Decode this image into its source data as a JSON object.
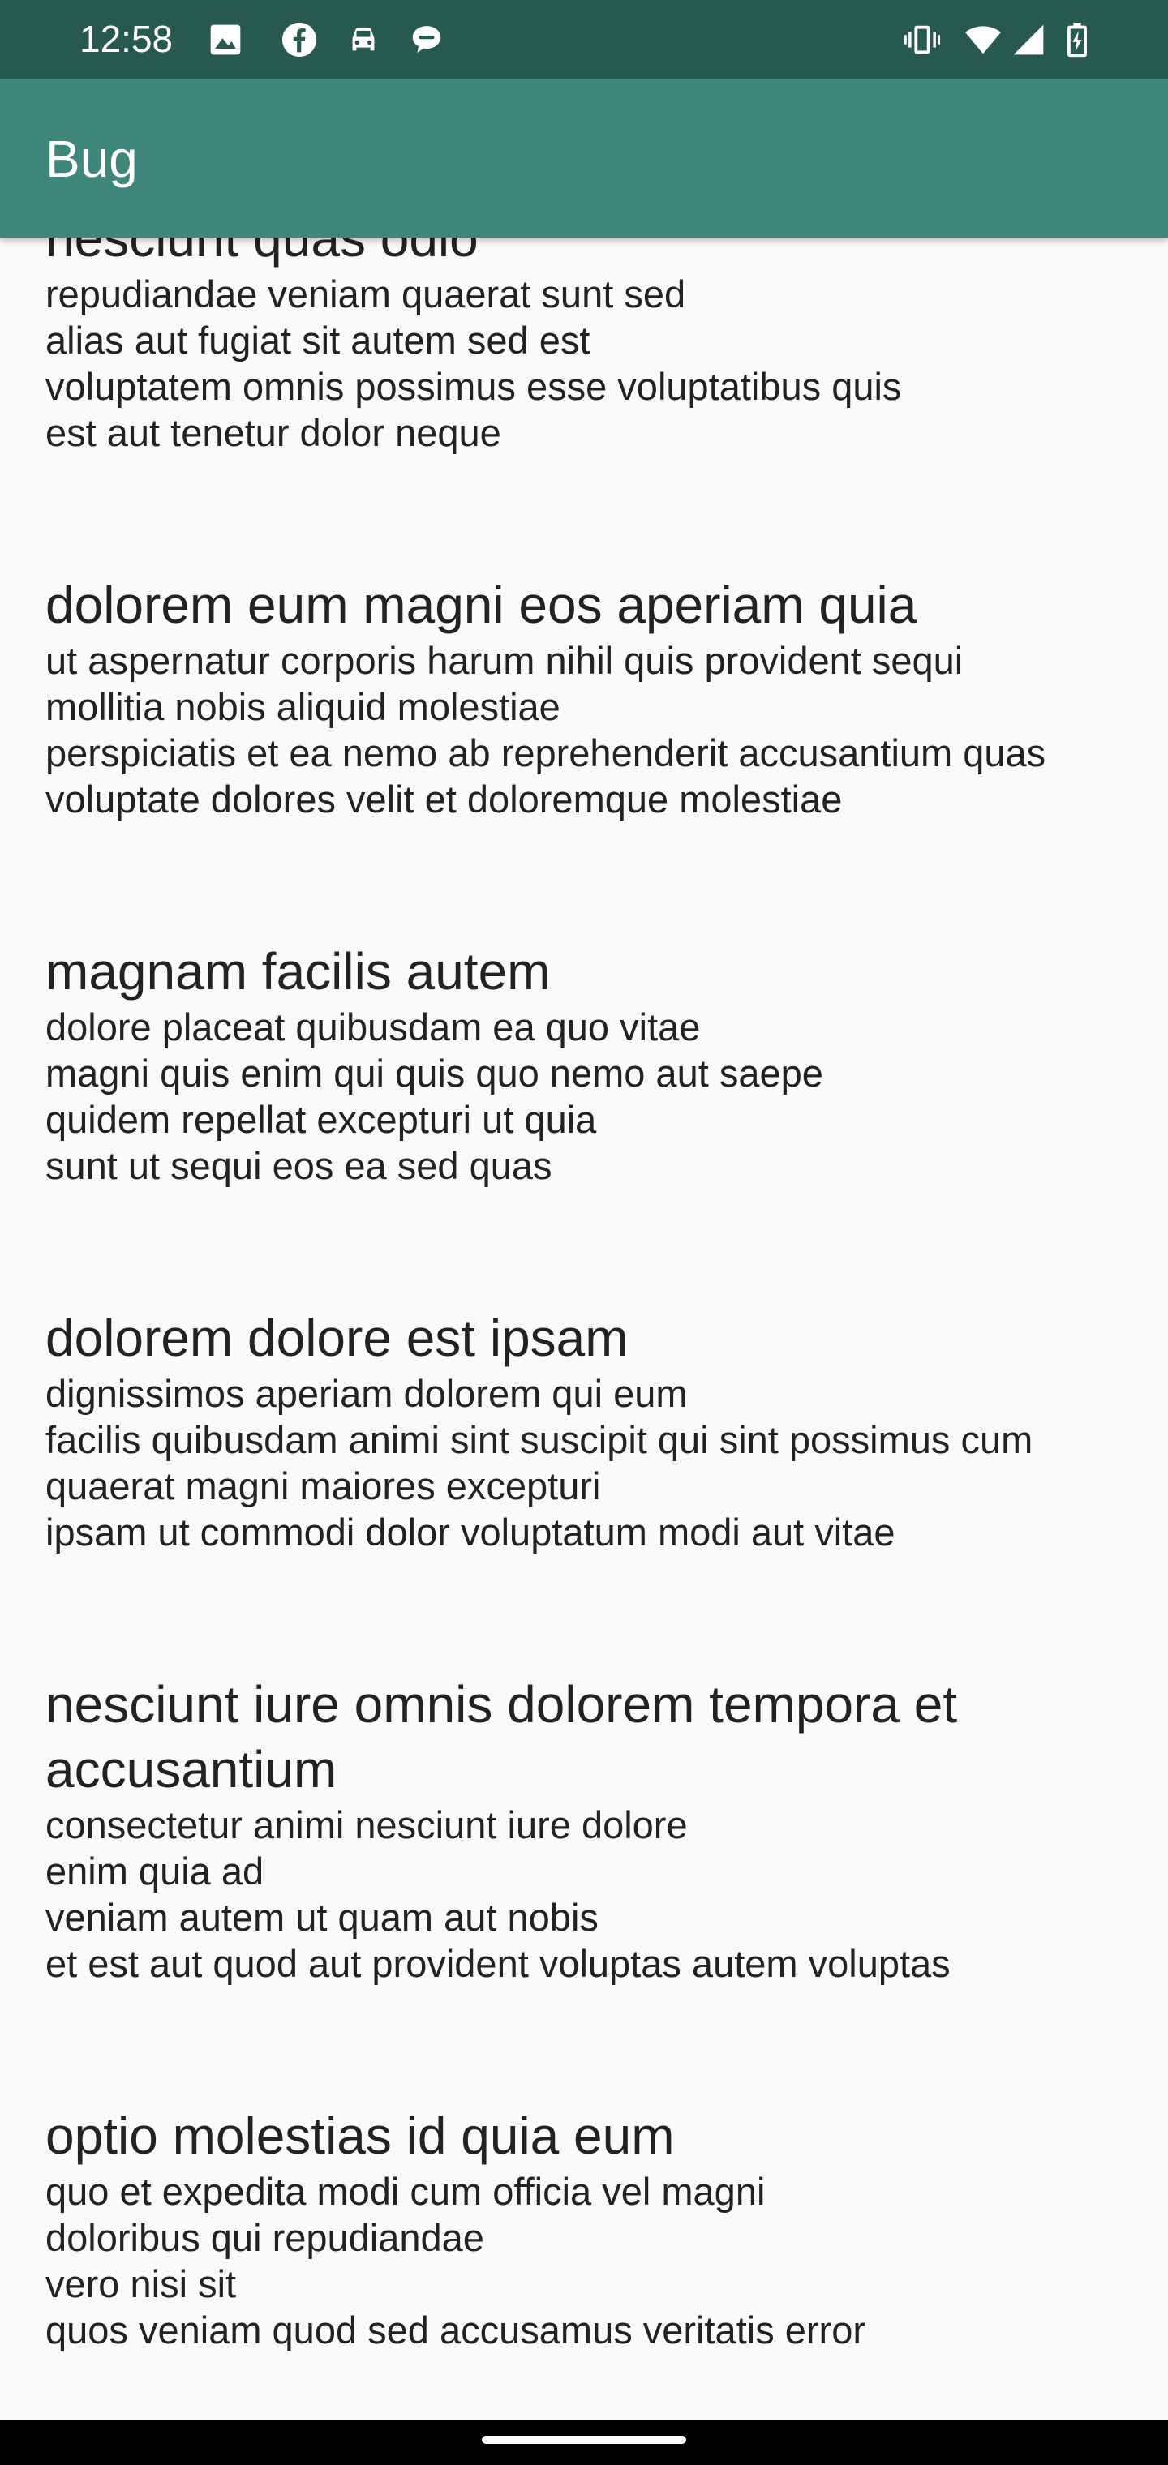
{
  "status_bar": {
    "time": "12:58",
    "left_icons": [
      "image-icon",
      "facebook-icon",
      "car-icon",
      "chat-bubble-icon"
    ],
    "right_icons": [
      "vibrate-icon",
      "wifi-icon",
      "signal-icon",
      "battery-charging-icon"
    ]
  },
  "app_bar": {
    "title": "Bug"
  },
  "posts": [
    {
      "title": "nesciunt quas odio",
      "body": [
        "repudiandae veniam quaerat sunt sed",
        "alias aut fugiat sit autem sed est",
        "voluptatem omnis possimus esse voluptatibus quis",
        "est aut tenetur dolor neque"
      ]
    },
    {
      "title": "dolorem eum magni eos aperiam quia",
      "body": [
        "ut aspernatur corporis harum nihil quis provident sequi",
        "mollitia nobis aliquid molestiae",
        "perspiciatis et ea nemo ab reprehenderit accusantium quas",
        "voluptate dolores velit et doloremque molestiae"
      ]
    },
    {
      "title": "magnam facilis autem",
      "body": [
        "dolore placeat quibusdam ea quo vitae",
        "magni quis enim qui quis quo nemo aut saepe",
        "quidem repellat excepturi ut quia",
        "sunt ut sequi eos ea sed quas"
      ]
    },
    {
      "title": "dolorem dolore est ipsam",
      "body": [
        "dignissimos aperiam dolorem qui eum",
        "facilis quibusdam animi sint suscipit qui sint possimus cum",
        "quaerat magni maiores excepturi",
        "ipsam ut commodi dolor voluptatum modi aut vitae"
      ]
    },
    {
      "title": "nesciunt iure omnis dolorem tempora et accusantium",
      "body": [
        "consectetur animi nesciunt iure dolore",
        "enim quia ad",
        "veniam autem ut quam aut nobis",
        "et est aut quod aut provident voluptas autem voluptas"
      ]
    },
    {
      "title": "optio molestias id quia eum",
      "body": [
        "quo et expedita modi cum officia vel magni",
        "doloribus qui repudiandae",
        "vero nisi sit",
        "quos veniam quod sed accusamus veritatis error"
      ]
    }
  ],
  "colors": {
    "status_bar": "#27594f",
    "app_bar": "#3e877a",
    "background": "#fafafa",
    "text": "#222222",
    "nav_bar": "#000000"
  }
}
